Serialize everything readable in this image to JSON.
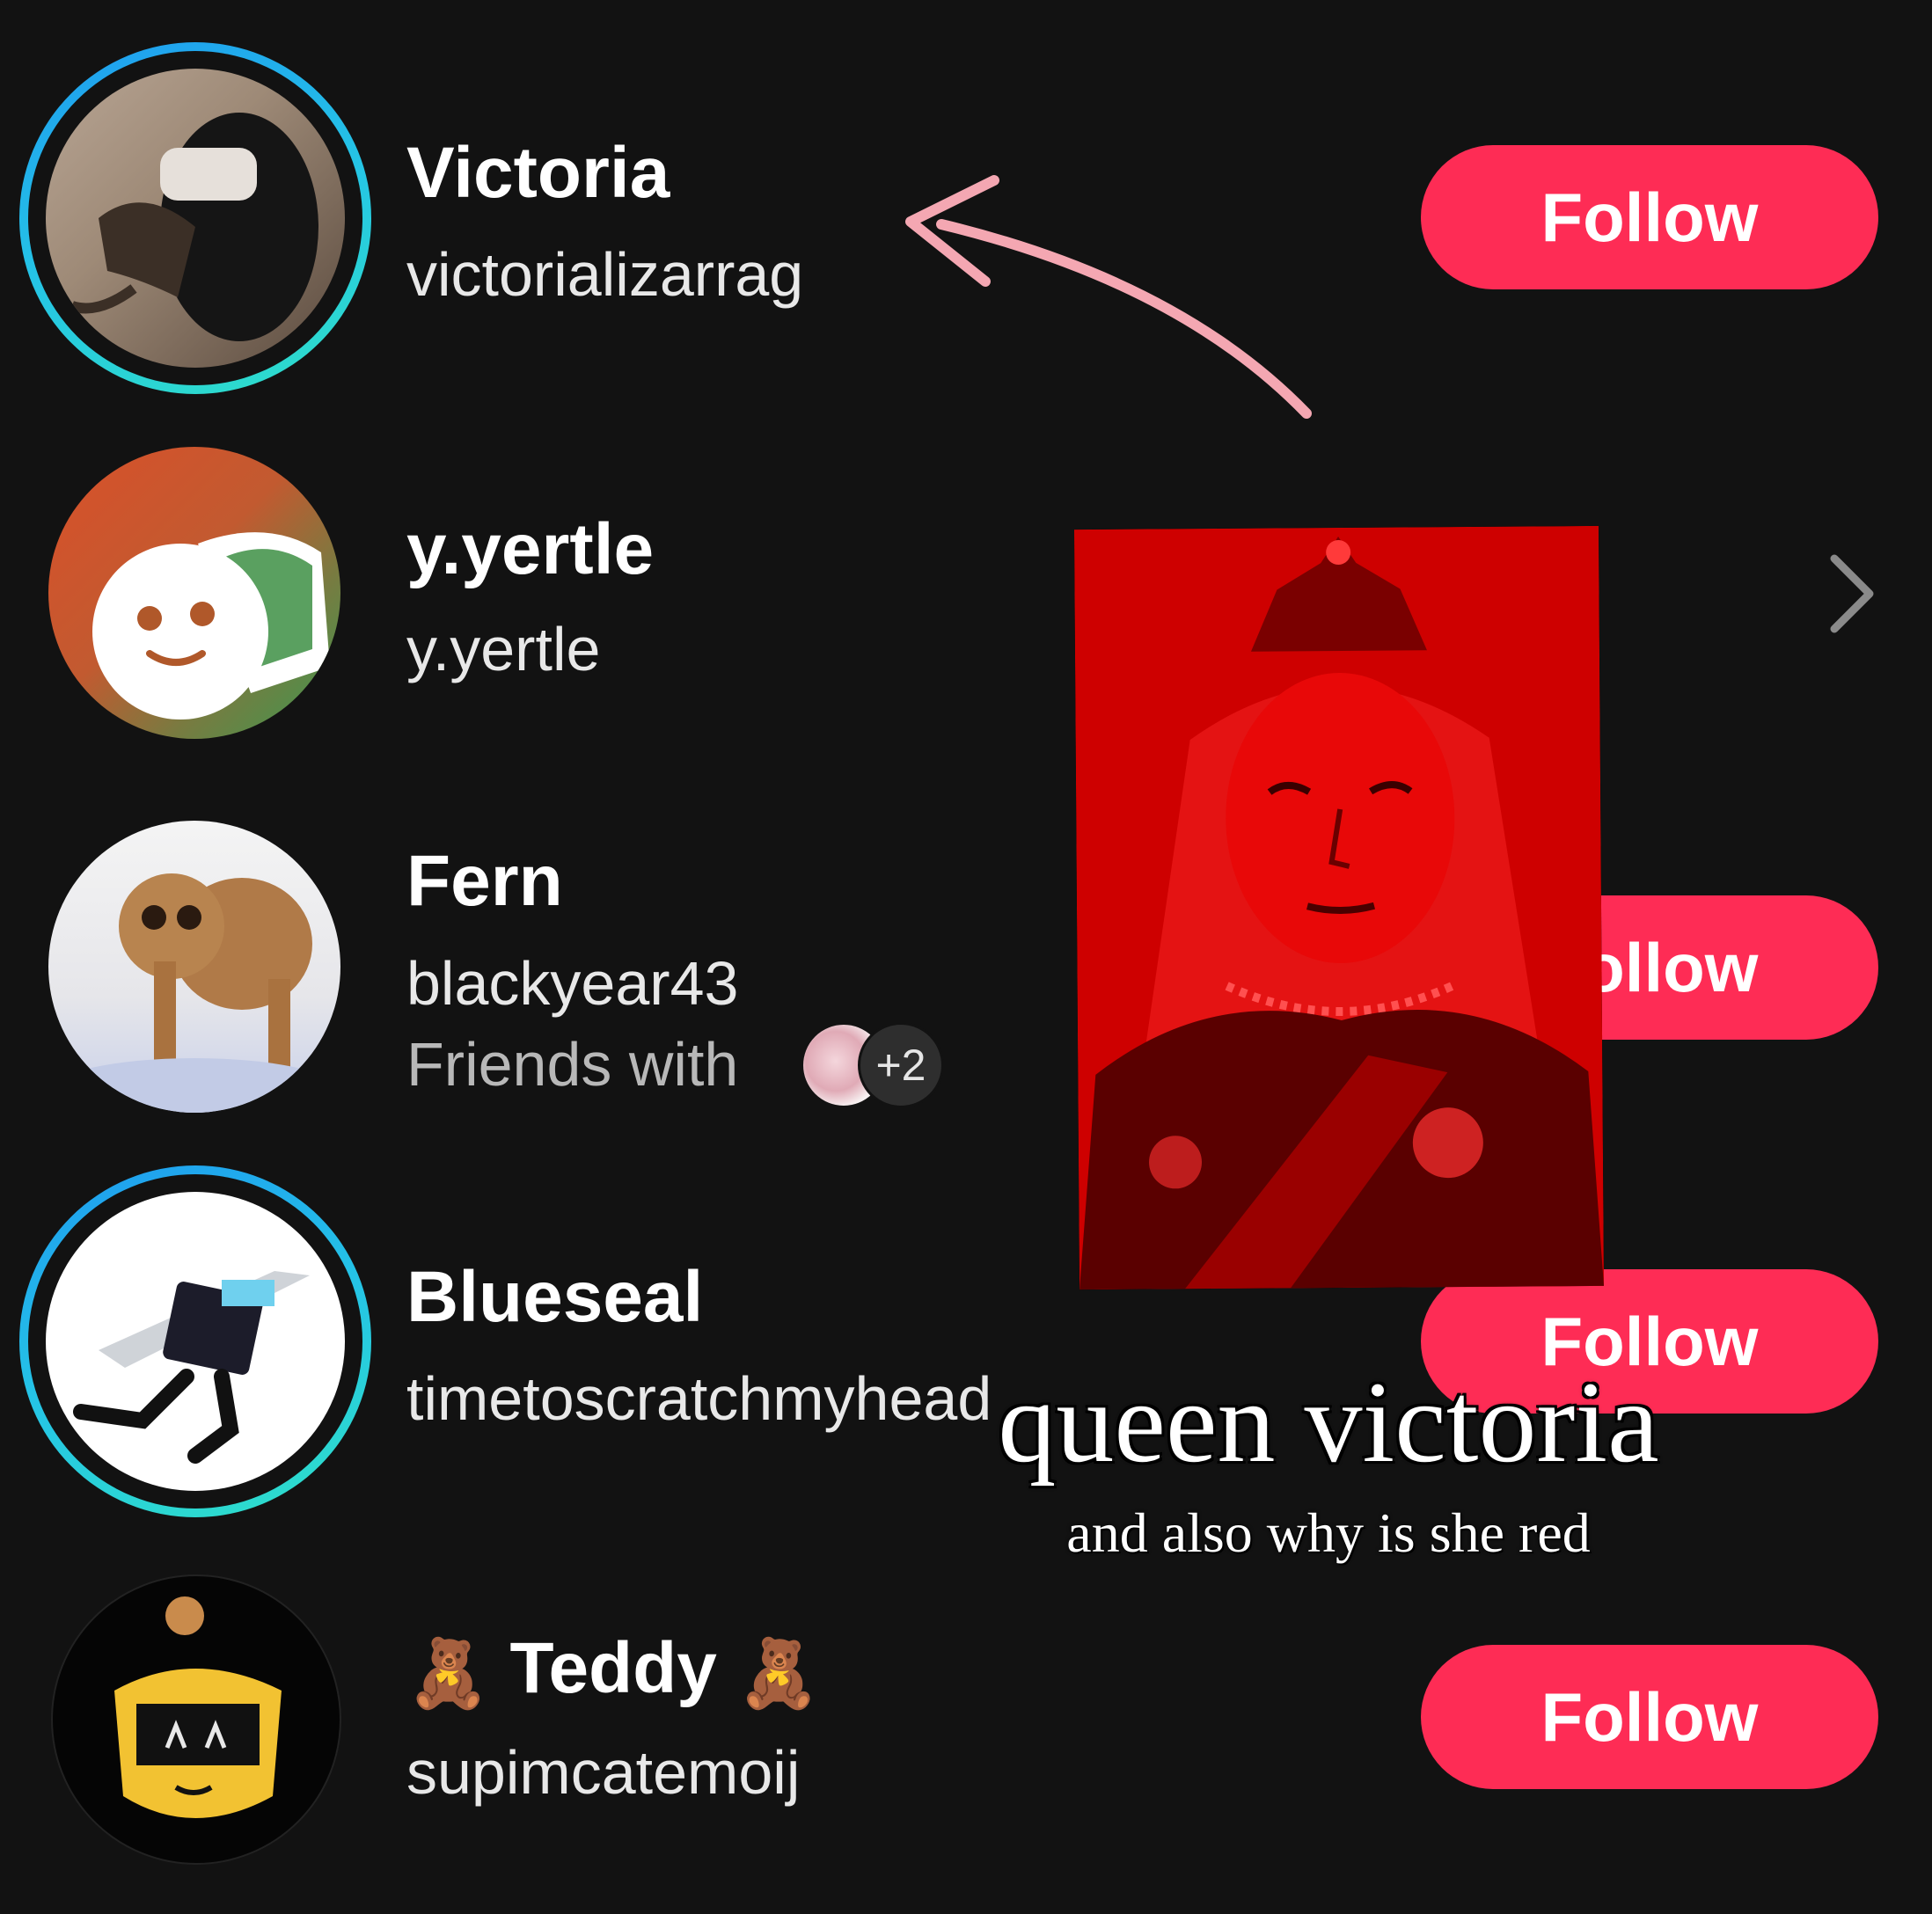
{
  "users": [
    {
      "display_name": "Victoria",
      "handle": "victorializarrag",
      "action": "Follow"
    },
    {
      "display_name": "y.yertle",
      "handle": "y.yertle"
    },
    {
      "display_name": "Fern",
      "handle": "blackyear43",
      "friends_prefix": "Friends with",
      "friends_more": "+2",
      "action": "Follow"
    },
    {
      "display_name": "Blueseal",
      "handle": "timetoscratchmyhead",
      "action": "Follow"
    },
    {
      "display_name": "Teddy",
      "display_emoji": "🧸",
      "handle": "supimcatemoij",
      "action": "Follow"
    }
  ],
  "overlay": {
    "caption": "queen victoria",
    "subcaption": "and also why is she red"
  },
  "colors": {
    "background": "#121212",
    "follow_button": "#fe2c55",
    "story_ring": "#1e9bf0",
    "arrow": "#f4a7b2",
    "portrait_tint": "#e00000"
  },
  "icons": [
    "chevron-right-icon",
    "arrow-annotation-icon"
  ]
}
